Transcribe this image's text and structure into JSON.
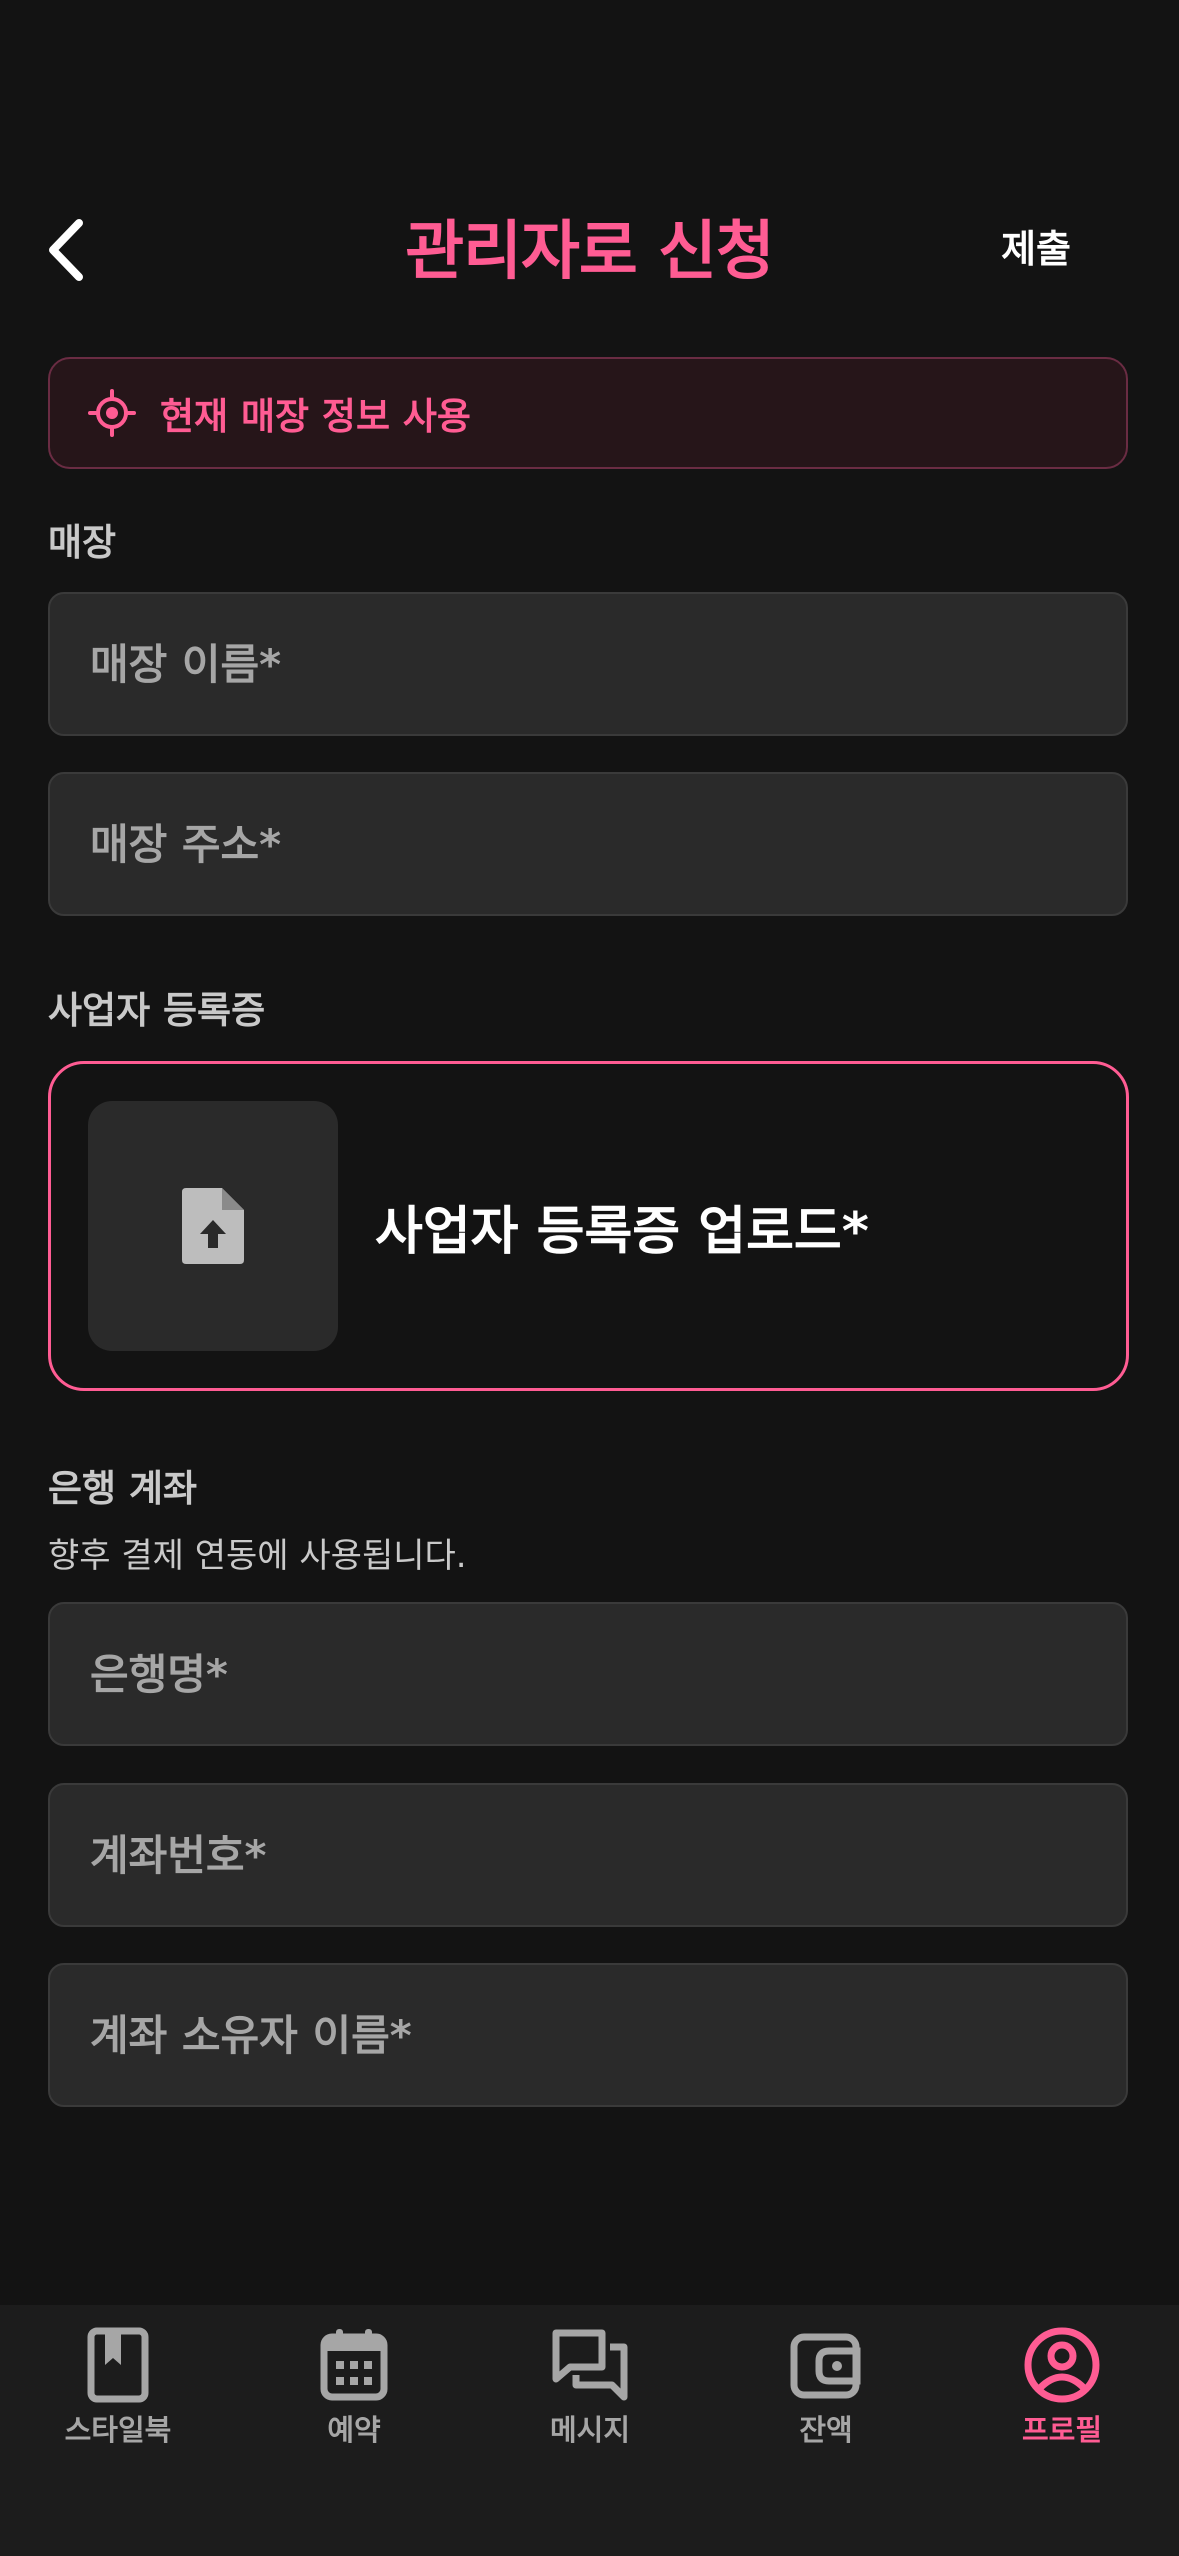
{
  "header": {
    "title": "관리자로 신청",
    "submit_label": "제출"
  },
  "location_banner": {
    "label": "현재 매장 정보 사용"
  },
  "store_section": {
    "label": "매장",
    "name_placeholder": "매장 이름*",
    "address_placeholder": "매장 주소*"
  },
  "business_section": {
    "label": "사업자 등록증",
    "upload_label": "사업자 등록증 업로드*"
  },
  "bank_section": {
    "label": "은행 계좌",
    "description": "향후 결제 연동에 사용됩니다.",
    "bank_name_placeholder": "은행명*",
    "account_number_placeholder": "계좌번호*",
    "account_holder_placeholder": "계좌 소유자 이름*"
  },
  "bottom_nav": {
    "items": [
      {
        "label": "스타일북",
        "icon": "book-icon"
      },
      {
        "label": "예약",
        "icon": "calendar-icon"
      },
      {
        "label": "메시지",
        "icon": "chat-icon"
      },
      {
        "label": "잔액",
        "icon": "wallet-icon"
      },
      {
        "label": "프로필",
        "icon": "profile-icon",
        "active": true
      }
    ]
  },
  "colors": {
    "background": "#131313",
    "accent": "#ff5c93",
    "field_bg": "#2a2a2a",
    "muted_text": "#a6a6a6",
    "nav_bg": "#1c1c1c"
  }
}
